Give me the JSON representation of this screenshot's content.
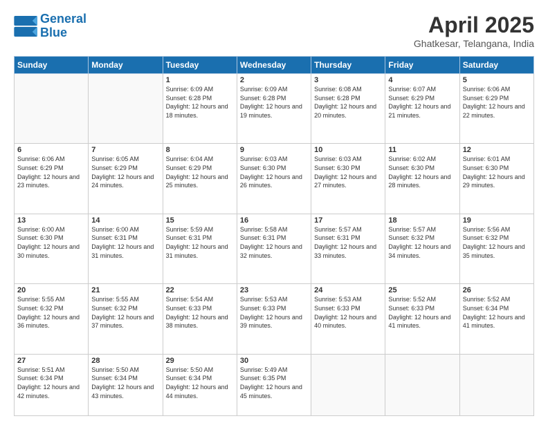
{
  "header": {
    "logo_line1": "General",
    "logo_line2": "Blue",
    "month": "April 2025",
    "location": "Ghatkesar, Telangana, India"
  },
  "weekdays": [
    "Sunday",
    "Monday",
    "Tuesday",
    "Wednesday",
    "Thursday",
    "Friday",
    "Saturday"
  ],
  "weeks": [
    [
      {
        "day": "",
        "info": ""
      },
      {
        "day": "",
        "info": ""
      },
      {
        "day": "1",
        "info": "Sunrise: 6:09 AM\nSunset: 6:28 PM\nDaylight: 12 hours and 18 minutes."
      },
      {
        "day": "2",
        "info": "Sunrise: 6:09 AM\nSunset: 6:28 PM\nDaylight: 12 hours and 19 minutes."
      },
      {
        "day": "3",
        "info": "Sunrise: 6:08 AM\nSunset: 6:28 PM\nDaylight: 12 hours and 20 minutes."
      },
      {
        "day": "4",
        "info": "Sunrise: 6:07 AM\nSunset: 6:29 PM\nDaylight: 12 hours and 21 minutes."
      },
      {
        "day": "5",
        "info": "Sunrise: 6:06 AM\nSunset: 6:29 PM\nDaylight: 12 hours and 22 minutes."
      }
    ],
    [
      {
        "day": "6",
        "info": "Sunrise: 6:06 AM\nSunset: 6:29 PM\nDaylight: 12 hours and 23 minutes."
      },
      {
        "day": "7",
        "info": "Sunrise: 6:05 AM\nSunset: 6:29 PM\nDaylight: 12 hours and 24 minutes."
      },
      {
        "day": "8",
        "info": "Sunrise: 6:04 AM\nSunset: 6:29 PM\nDaylight: 12 hours and 25 minutes."
      },
      {
        "day": "9",
        "info": "Sunrise: 6:03 AM\nSunset: 6:30 PM\nDaylight: 12 hours and 26 minutes."
      },
      {
        "day": "10",
        "info": "Sunrise: 6:03 AM\nSunset: 6:30 PM\nDaylight: 12 hours and 27 minutes."
      },
      {
        "day": "11",
        "info": "Sunrise: 6:02 AM\nSunset: 6:30 PM\nDaylight: 12 hours and 28 minutes."
      },
      {
        "day": "12",
        "info": "Sunrise: 6:01 AM\nSunset: 6:30 PM\nDaylight: 12 hours and 29 minutes."
      }
    ],
    [
      {
        "day": "13",
        "info": "Sunrise: 6:00 AM\nSunset: 6:30 PM\nDaylight: 12 hours and 30 minutes."
      },
      {
        "day": "14",
        "info": "Sunrise: 6:00 AM\nSunset: 6:31 PM\nDaylight: 12 hours and 31 minutes."
      },
      {
        "day": "15",
        "info": "Sunrise: 5:59 AM\nSunset: 6:31 PM\nDaylight: 12 hours and 31 minutes."
      },
      {
        "day": "16",
        "info": "Sunrise: 5:58 AM\nSunset: 6:31 PM\nDaylight: 12 hours and 32 minutes."
      },
      {
        "day": "17",
        "info": "Sunrise: 5:57 AM\nSunset: 6:31 PM\nDaylight: 12 hours and 33 minutes."
      },
      {
        "day": "18",
        "info": "Sunrise: 5:57 AM\nSunset: 6:32 PM\nDaylight: 12 hours and 34 minutes."
      },
      {
        "day": "19",
        "info": "Sunrise: 5:56 AM\nSunset: 6:32 PM\nDaylight: 12 hours and 35 minutes."
      }
    ],
    [
      {
        "day": "20",
        "info": "Sunrise: 5:55 AM\nSunset: 6:32 PM\nDaylight: 12 hours and 36 minutes."
      },
      {
        "day": "21",
        "info": "Sunrise: 5:55 AM\nSunset: 6:32 PM\nDaylight: 12 hours and 37 minutes."
      },
      {
        "day": "22",
        "info": "Sunrise: 5:54 AM\nSunset: 6:33 PM\nDaylight: 12 hours and 38 minutes."
      },
      {
        "day": "23",
        "info": "Sunrise: 5:53 AM\nSunset: 6:33 PM\nDaylight: 12 hours and 39 minutes."
      },
      {
        "day": "24",
        "info": "Sunrise: 5:53 AM\nSunset: 6:33 PM\nDaylight: 12 hours and 40 minutes."
      },
      {
        "day": "25",
        "info": "Sunrise: 5:52 AM\nSunset: 6:33 PM\nDaylight: 12 hours and 41 minutes."
      },
      {
        "day": "26",
        "info": "Sunrise: 5:52 AM\nSunset: 6:34 PM\nDaylight: 12 hours and 41 minutes."
      }
    ],
    [
      {
        "day": "27",
        "info": "Sunrise: 5:51 AM\nSunset: 6:34 PM\nDaylight: 12 hours and 42 minutes."
      },
      {
        "day": "28",
        "info": "Sunrise: 5:50 AM\nSunset: 6:34 PM\nDaylight: 12 hours and 43 minutes."
      },
      {
        "day": "29",
        "info": "Sunrise: 5:50 AM\nSunset: 6:34 PM\nDaylight: 12 hours and 44 minutes."
      },
      {
        "day": "30",
        "info": "Sunrise: 5:49 AM\nSunset: 6:35 PM\nDaylight: 12 hours and 45 minutes."
      },
      {
        "day": "",
        "info": ""
      },
      {
        "day": "",
        "info": ""
      },
      {
        "day": "",
        "info": ""
      }
    ]
  ]
}
